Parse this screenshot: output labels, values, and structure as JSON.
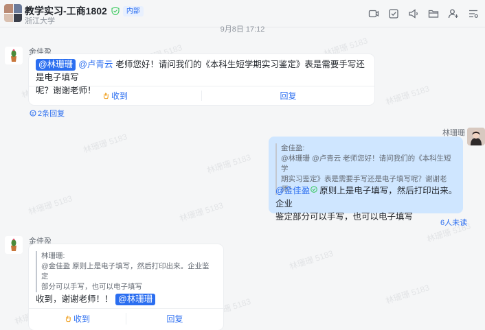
{
  "header": {
    "title": "教学实习-工商1802",
    "badge": "内部",
    "subtitle": "浙江大学",
    "toolbar": [
      {
        "icon": "video-icon"
      },
      {
        "icon": "task-check-icon"
      },
      {
        "icon": "announcement-icon"
      },
      {
        "icon": "folder-icon"
      },
      {
        "icon": "add-member-icon"
      },
      {
        "icon": "settings-list-icon"
      }
    ]
  },
  "timestamp": "9月8日 17:12",
  "watermark": "林珊珊 5183",
  "messages": {
    "m1": {
      "sender": "金佳盈",
      "mention_pill": "@林珊珊",
      "mention_link": "@卢青云",
      "text_line1": "老师您好！请问我们的《本科生短学期实习鉴定》表是需要手写还是电子填写",
      "text_line2": "呢？谢谢老师！",
      "action_received": "收到",
      "action_reply": "回复",
      "reply_count": "2条回复"
    },
    "m2": {
      "sender": "林珊珊",
      "quote_author": "金佳盈:",
      "quote_line1": "@林珊珊 @卢青云 老师您好！请问我们的《本科生短学",
      "quote_line2": "期实习鉴定》表是需要手写还是电子填写呢？谢谢老师！",
      "mention": "@金佳盈",
      "text_line1": "原则上是电子填写，然后打印出来。企业",
      "text_line2": "鉴定部分可以手写，也可以电子填写",
      "unread": "6人未读"
    },
    "m3": {
      "sender": "金佳盈",
      "quote_author": "林珊珊:",
      "quote_line1": "@金佳盈 原则上是电子填写，然后打印出来。企业鉴定",
      "quote_line2": "部分可以手写，也可以电子填写",
      "text": "收到，谢谢老师！！",
      "mention_pill": "@林珊珊",
      "action_received": "收到",
      "action_reply": "回复"
    }
  },
  "colors": {
    "accent": "#2b6ef0",
    "my_bubble": "#cfe6ff",
    "background": "#f5f6f7"
  }
}
